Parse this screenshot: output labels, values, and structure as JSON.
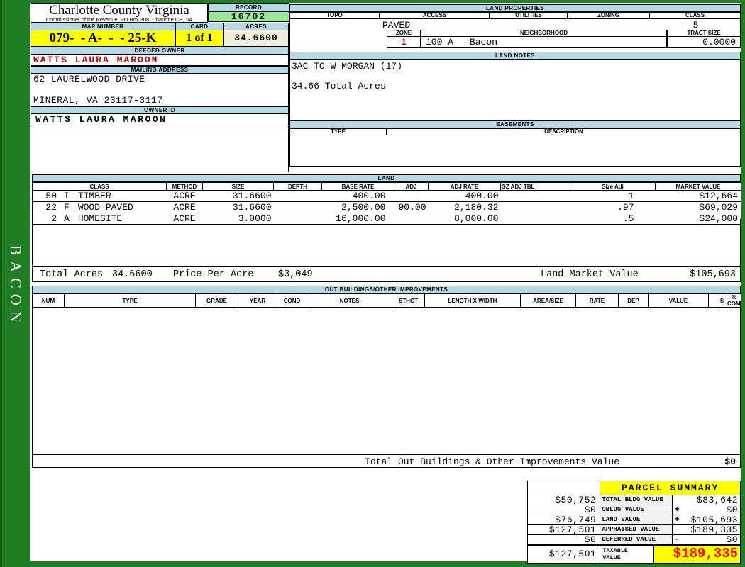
{
  "county": {
    "title": "Charlotte County Virginia",
    "subtitle": "Commissioner of the Revenue, PO Box 308, Charlotte CH, VA"
  },
  "record": {
    "label": "RECORD",
    "value": "16702"
  },
  "map_number": {
    "label": "MAP NUMBER",
    "value": "079-  - A-  -  - 25-K"
  },
  "card": {
    "label": "CARD",
    "value": "1 of 1"
  },
  "acres": {
    "label": "ACRES",
    "value": "34.6600"
  },
  "owner": {
    "deeded_label": "DEEDED OWNER",
    "deeded_name": "WATTS LAURA MAROON",
    "mailing_label": "MAILING ADDRESS",
    "address_line1": "62 LAURELWOOD DRIVE",
    "address_line2": "MINERAL, VA 23117-3117",
    "id_label": "OWNER ID",
    "id_value": "WATTS LAURA MAROON"
  },
  "land_properties": {
    "title": "LAND PROPERTIES",
    "col_topo": "TOPO",
    "col_access": "ACCESS",
    "col_utilities": "UTILITIES",
    "col_zoning": "ZONING",
    "col_class": "CLASS",
    "access_value": "PAVED",
    "class_value": "5",
    "zone_label": "ZONE",
    "zone_value": "1",
    "neighborhood_label": "NEIGHBORHOOD",
    "neighborhood_code": "100 A",
    "neighborhood_name": "Bacon",
    "tract_label": "TRACT SIZE",
    "tract_value": "0.0000"
  },
  "land_notes": {
    "title": "LAND NOTES",
    "line1": "3AC TO W MORGAN (17)",
    "line2": "34.66 Total Acres"
  },
  "easements": {
    "title": "EASEMENTS",
    "col_type": "TYPE",
    "col_description": "DESCRIPTION"
  },
  "land": {
    "title": "LAND",
    "headers": [
      "CLASS",
      "METHOD",
      "SIZE",
      "DEPTH",
      "BASE RATE",
      "ADJ",
      "ADJ RATE",
      "SZ ADJ TBL",
      "",
      "Size Adj",
      "MARKET VALUE"
    ],
    "rows": [
      {
        "num": "50",
        "code": "I",
        "class_name": "TIMBER",
        "method": "ACRE",
        "size": "31.6600",
        "depth": "",
        "base_rate": "400.00",
        "adj": "",
        "adj_rate": "400.00",
        "sz_adj_tbl": "",
        "size_adj": "1",
        "market_value": "$12,664"
      },
      {
        "num": "22",
        "code": "F",
        "class_name": "WOOD PAVED",
        "method": "ACRE",
        "size": "31.6600",
        "depth": "",
        "base_rate": "2,500.00",
        "adj": "90.00",
        "adj_rate": "2,180.32",
        "sz_adj_tbl": "",
        "size_adj": ".97",
        "market_value": "$69,029"
      },
      {
        "num": "2",
        "code": "A",
        "class_name": "HOMESITE",
        "method": "ACRE",
        "size": "3.0000",
        "depth": "",
        "base_rate": "16,000.00",
        "adj": "",
        "adj_rate": "8,000.00",
        "sz_adj_tbl": "",
        "size_adj": ".5",
        "market_value": "$24,000"
      }
    ],
    "total_acres_label": "Total Acres",
    "total_acres": "34.6600",
    "price_per_acre_label": "Price Per Acre",
    "price_per_acre": "$3,049",
    "land_market_label": "Land Market Value",
    "land_market_value": "$105,693"
  },
  "out_buildings": {
    "title": "OUT BUILDINGS/OTHER IMPROVEMENTS",
    "headers": [
      "NUM",
      "TYPE",
      "GRADE",
      "YEAR",
      "COND",
      "NOTES",
      "STHGT",
      "LENGTH X WIDTH",
      "AREA/SIZE",
      "RATE",
      "DEP",
      "VALUE",
      "",
      "S",
      "% COMP"
    ],
    "total_label": "Total Out Buildings & Other Improvements Value",
    "total_value": "$0"
  },
  "parcel_summary": {
    "title": "PARCEL SUMMARY",
    "rows": [
      {
        "prior": "$50,752",
        "label": "TOTAL BLDG VALUE",
        "op": "",
        "value": "$83,642"
      },
      {
        "prior": "$0",
        "label": "OBLDG VALUE",
        "op": "+",
        "value": "$0"
      },
      {
        "prior": "$76,749",
        "label": "LAND VALUE",
        "op": "+",
        "value": "$105,693"
      },
      {
        "prior": "$127,501",
        "label": "APPRAISED VALUE",
        "op": "",
        "value": "$189,335"
      },
      {
        "prior": "$0",
        "label": "DEFERRED VALUE",
        "op": "-",
        "value": "$0"
      }
    ],
    "taxable_prior": "$127,501",
    "taxable_label_line1": "TAXABLE",
    "taxable_label_line2": "VALUE",
    "taxable_value": "$189,335"
  },
  "sidebar": {
    "label": "BACON"
  },
  "colors": {
    "frame_green": "#1F7E23",
    "band_blue": "#B4DAE7",
    "record_green": "#98E898",
    "highlight_yellow": "#FFFF00",
    "acres_cream": "#F1EFDC",
    "owner_red": "#C00000",
    "taxable_red": "#FF0000"
  }
}
